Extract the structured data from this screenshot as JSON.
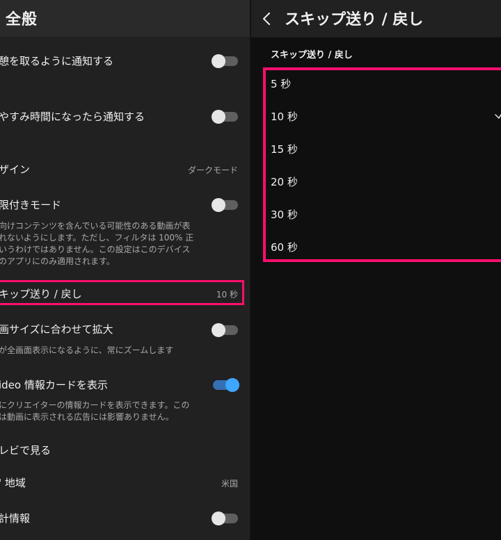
{
  "left_panel": {
    "title": "全般",
    "rows": [
      {
        "title": "憩を取るように通知する",
        "control": "toggle",
        "state": "off"
      },
      {
        "title": "やすみ時間になったら通知する",
        "control": "toggle",
        "state": "off"
      },
      {
        "title": "ザイン",
        "value": "ダークモード"
      },
      {
        "title": "限付きモード",
        "control": "toggle",
        "state": "off",
        "description": "向けコンテンツを含んでいる可能性のある動画が表\nれないようにします。ただし、フィルタは 100% 正\nいうわけではありません。この設定はこのデバイス\nのアプリにのみ適用されます。"
      },
      {
        "title": "キップ送り / 戻し",
        "value": "10 秒"
      },
      {
        "title": "画サイズに合わせて拡大",
        "control": "toggle",
        "state": "off",
        "description": "が全画面表示になるように、常にズームします"
      },
      {
        "title": "ideo 情報カードを表示",
        "control": "toggle",
        "state": "on",
        "description": "にクリエイターの情報カードを表示できます。この\nは動画に表示される広告には影響ありません。"
      },
      {
        "title": "レビで見る"
      },
      {
        "title": "' 地域",
        "value": "米国"
      },
      {
        "title": "計情報",
        "control": "toggle",
        "state": "off"
      }
    ]
  },
  "right_panel": {
    "title": "スキップ送り / 戻し",
    "section_label": "スキップ送り / 戻し",
    "options": [
      "5 秒",
      "10 秒",
      "15 秒",
      "20 秒",
      "30 秒",
      "60 秒"
    ],
    "selected_index": 1
  },
  "icons": {
    "back": "chevron-left-icon",
    "check": "check-icon"
  },
  "colors": {
    "highlight": "#ff0e6e",
    "toggle_on": "#3ea6ff",
    "toggle_off": "#e6e6e6"
  }
}
